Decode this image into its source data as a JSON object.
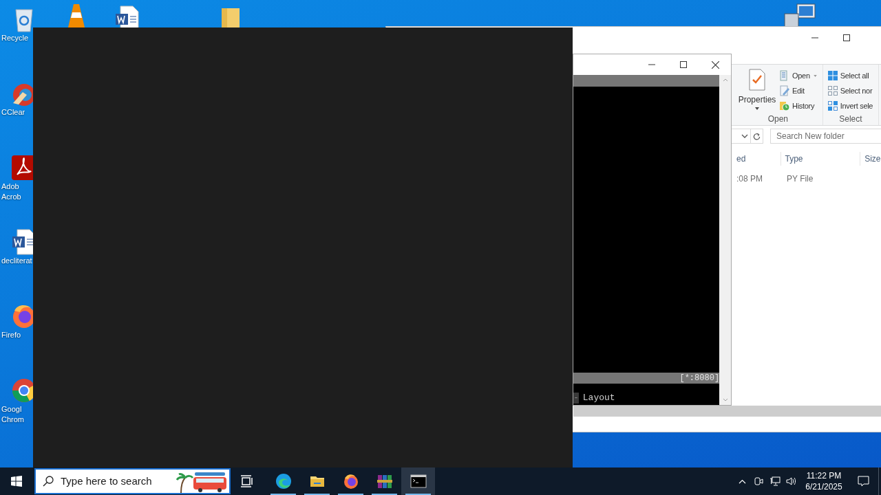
{
  "desktop": {
    "icons": [
      {
        "kind": "recycle",
        "label": [
          "Recycle"
        ]
      },
      {
        "kind": "ccleaner",
        "label": [
          "CClear"
        ]
      },
      {
        "kind": "acrobat",
        "label": [
          "Adob",
          "Acrob"
        ]
      },
      {
        "kind": "word",
        "label": [
          "decliterat"
        ]
      },
      {
        "kind": "firefox",
        "label": [
          "Firefo"
        ]
      },
      {
        "kind": "chrome",
        "label": [
          "Googl",
          "Chrom"
        ]
      }
    ]
  },
  "explorer": {
    "ribbon": {
      "groups": [
        {
          "title": "Open",
          "large": "Properties",
          "items": [
            {
              "kind": "open",
              "label": "Open",
              "menu": true
            },
            {
              "kind": "edit",
              "label": "Edit",
              "menu": false
            },
            {
              "kind": "history",
              "label": "History",
              "menu": false
            }
          ]
        },
        {
          "title": "Select",
          "items": [
            {
              "kind": "select-all",
              "label": "Select all",
              "menu": false
            },
            {
              "kind": "select-none",
              "label": "Select nor",
              "menu": false
            },
            {
              "kind": "invert",
              "label": "Invert sele",
              "menu": false
            }
          ]
        }
      ]
    },
    "search": {
      "placeholder": "Search New folder"
    },
    "columns": [
      "ed",
      "Type",
      "Size"
    ],
    "rows": [
      [
        ":08 PM",
        "PY File"
      ]
    ]
  },
  "console": {
    "status": "[*:8080]",
    "marker": "-",
    "line": "Layout"
  },
  "taskbar": {
    "search": {
      "placeholder": "Type here to search"
    },
    "apps": [
      {
        "kind": "taskview",
        "running": false,
        "selected": false
      },
      {
        "kind": "edge",
        "running": true,
        "selected": false
      },
      {
        "kind": "explorer",
        "running": true,
        "selected": false
      },
      {
        "kind": "firefox",
        "running": true,
        "selected": false
      },
      {
        "kind": "winrar",
        "running": true,
        "selected": false
      },
      {
        "kind": "console",
        "running": true,
        "selected": true
      }
    ],
    "time": "11:22 PM",
    "date": "6/21/2025"
  }
}
